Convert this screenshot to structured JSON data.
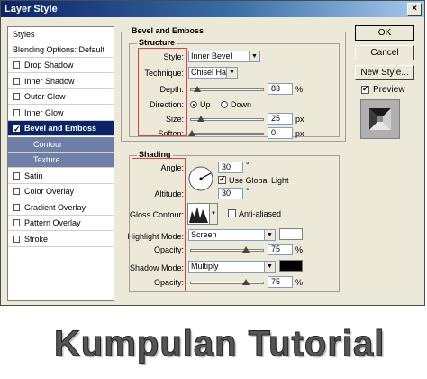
{
  "window": {
    "title": "Layer Style",
    "close_label": "×"
  },
  "sidebar": {
    "header": "Styles",
    "blending": "Blending Options: Default",
    "items": [
      {
        "label": "Drop Shadow",
        "checked": false
      },
      {
        "label": "Inner Shadow",
        "checked": false
      },
      {
        "label": "Outer Glow",
        "checked": false
      },
      {
        "label": "Inner Glow",
        "checked": false
      },
      {
        "label": "Bevel and Emboss",
        "checked": true,
        "selected": true
      },
      {
        "label": "Contour",
        "checked": false,
        "sub": true
      },
      {
        "label": "Texture",
        "checked": false,
        "sub": true
      },
      {
        "label": "Satin",
        "checked": false
      },
      {
        "label": "Color Overlay",
        "checked": false
      },
      {
        "label": "Gradient Overlay",
        "checked": false
      },
      {
        "label": "Pattern Overlay",
        "checked": false
      },
      {
        "label": "Stroke",
        "checked": false
      }
    ]
  },
  "bevel": {
    "section_title": "Bevel and Emboss",
    "structure_title": "Structure",
    "style_label": "Style:",
    "style_value": "Inner Bevel",
    "technique_label": "Technique:",
    "technique_value": "Chisel Hard",
    "depth_label": "Depth:",
    "depth_value": "83",
    "depth_unit": "%",
    "depth_level": 0.08,
    "direction_label": "Direction:",
    "direction_up": "Up",
    "direction_down": "Down",
    "direction_selected": "Up",
    "size_label": "Size:",
    "size_value": "25",
    "size_unit": "px",
    "size_level": 0.12,
    "soften_label": "Soften:",
    "soften_value": "0",
    "soften_unit": "px",
    "soften_level": 0.0
  },
  "shading": {
    "title": "Shading",
    "angle_label": "Angle:",
    "angle_value": "30",
    "angle_unit": "°",
    "global_light_label": "Use Global Light",
    "global_light_checked": true,
    "altitude_label": "Altitude:",
    "altitude_value": "30",
    "altitude_unit": "°",
    "gloss_label": "Gloss Contour:",
    "antialiased_label": "Anti-aliased",
    "antialiased_checked": false,
    "highlight_label": "Highlight Mode:",
    "highlight_value": "Screen",
    "highlight_color": "#ffffff",
    "opacity1_label": "Opacity:",
    "opacity1_value": "75",
    "opacity1_unit": "%",
    "opacity1_level": 0.75,
    "shadow_label": "Shadow Mode:",
    "shadow_value": "Multiply",
    "shadow_color": "#000000",
    "opacity2_label": "Opacity:",
    "opacity2_value": "75",
    "opacity2_unit": "%",
    "opacity2_level": 0.75
  },
  "buttons": {
    "ok": "OK",
    "cancel": "Cancel",
    "new_style": "New Style...",
    "preview": "Preview",
    "preview_checked": true
  },
  "footer": {
    "text": "Kumpulan Tutorial"
  }
}
